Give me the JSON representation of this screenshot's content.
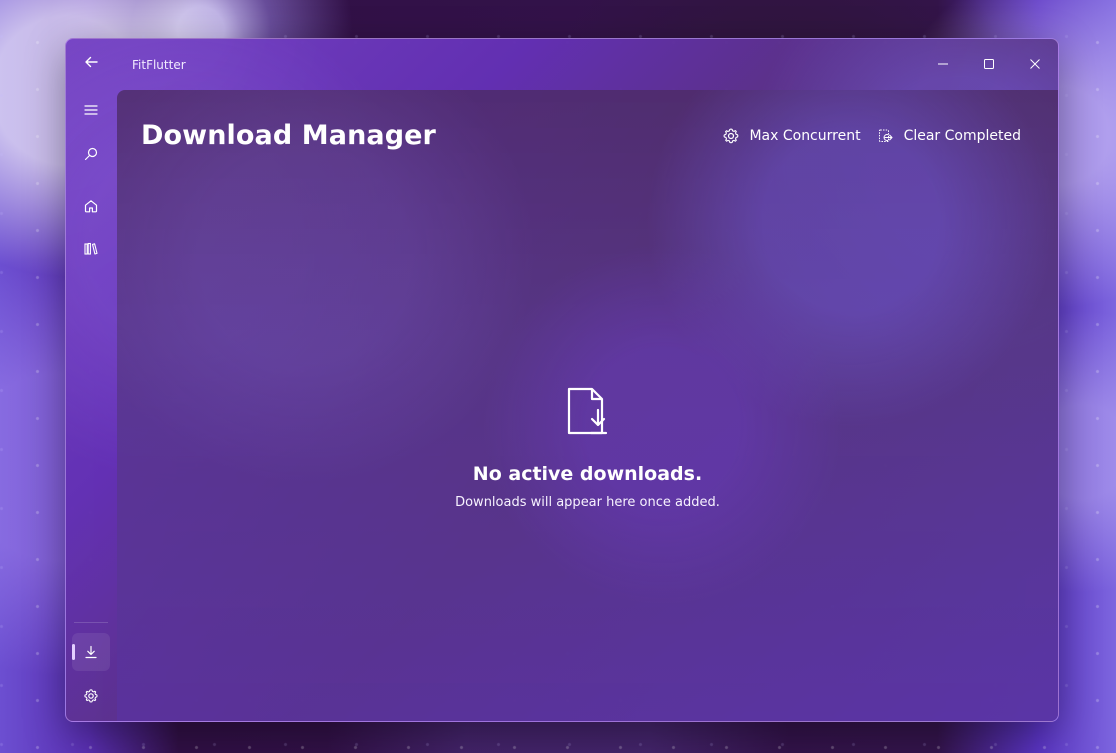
{
  "app": {
    "title": "FitFlutter"
  },
  "window": {
    "controls": [
      "minimize-icon",
      "maximize-icon",
      "close-icon"
    ]
  },
  "navigation": {
    "items": [
      {
        "icon": "menu-icon"
      },
      {
        "icon": "search-icon"
      },
      {
        "icon": "home-icon"
      },
      {
        "icon": "library-icon"
      },
      {
        "icon": "download-icon",
        "selected": true
      },
      {
        "icon": "settings-icon"
      }
    ]
  },
  "page": {
    "title": "Download Manager"
  },
  "toolbar": {
    "max_concurrent_label": "Max Concurrent",
    "clear_completed_label": "Clear Completed",
    "max_concurrent_icon": "gear-icon",
    "clear_completed_icon": "clear-completed-icon"
  },
  "empty_state": {
    "icon": "file-download-icon",
    "title": "No active downloads.",
    "subtitle": "Downloads will appear here once added."
  },
  "colors": {
    "accent": "#e4cfff",
    "text": "#ffffff"
  }
}
